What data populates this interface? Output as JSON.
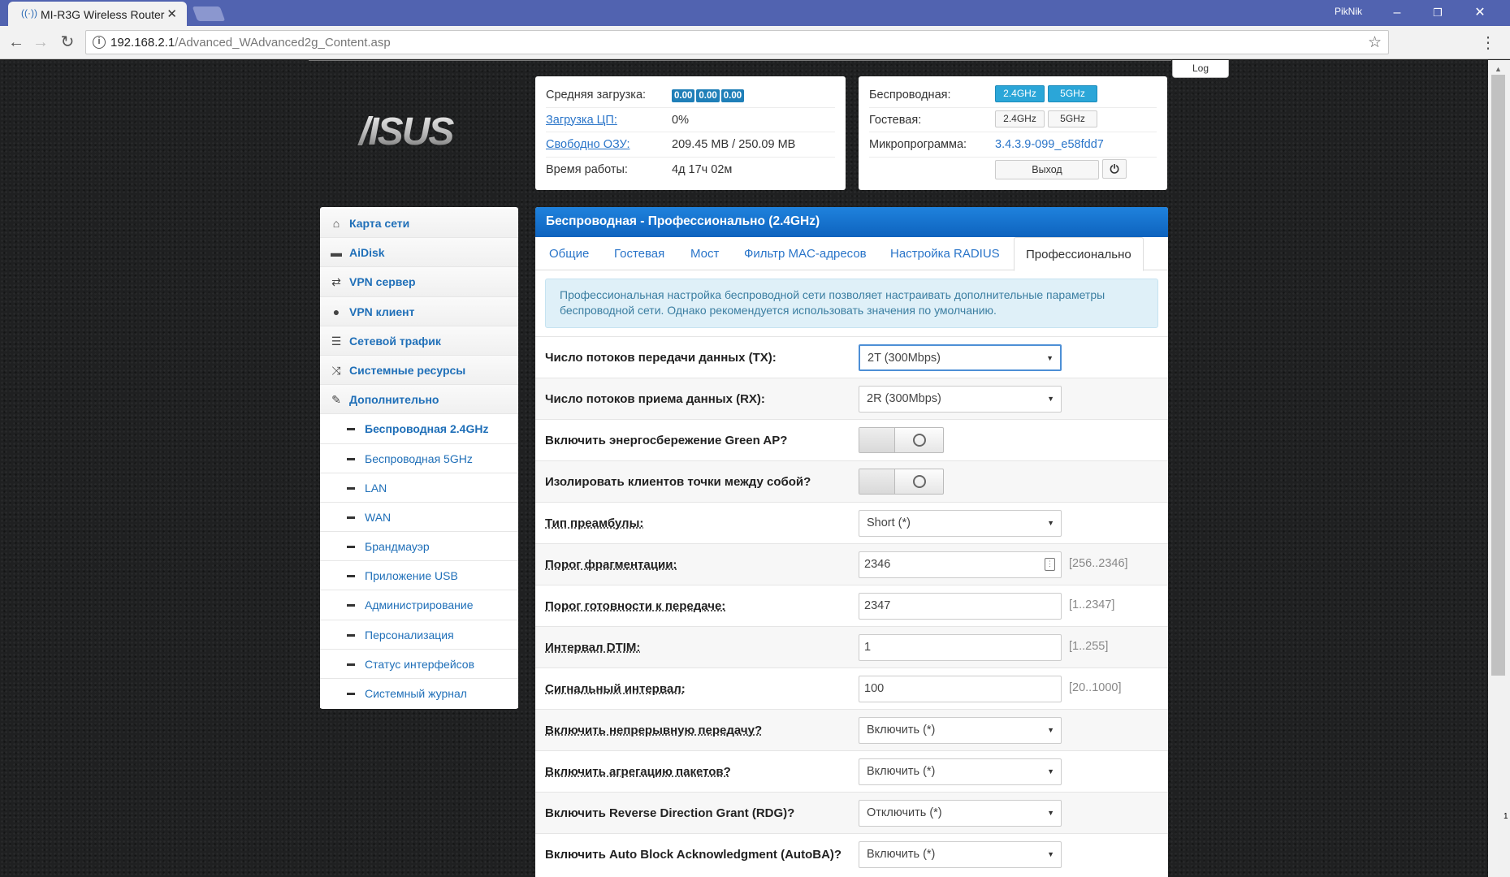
{
  "browser": {
    "tab_title": "MI-R3G Wireless Router",
    "favicon": "((·))",
    "close_glyph": "✕",
    "user": "PikNik",
    "minimize_glyph": "–",
    "restore_glyph": "❐",
    "close_window_glyph": "✕",
    "url_host": "192.168.2.1",
    "url_path": "/Advanced_WAdvanced2g_Content.asp"
  },
  "log_label": "Log",
  "logo_text": "/ISUS",
  "status": {
    "avg_load_label": "Средняя загрузка:",
    "avg_load_values": [
      "0.00",
      "0.00",
      "0.00"
    ],
    "cpu_label": "Загрузка ЦП:",
    "cpu_value": "0%",
    "ram_label": "Свободно ОЗУ:",
    "ram_value": "209.45 MB / 250.09 MB",
    "uptime_label": "Время работы:",
    "uptime_value": "4д 17ч 02м",
    "wireless_label": "Беспроводная:",
    "wireless_24": "2.4GHz",
    "wireless_5": "5GHz",
    "guest_label": "Гостевая:",
    "guest_24": "2.4GHz",
    "guest_5": "5GHz",
    "firmware_label": "Микропрограмма:",
    "firmware_value": "3.4.3.9-099_e58fdd7",
    "exit_label": "Выход",
    "power_glyph": "⏻"
  },
  "sidebar": {
    "items": [
      {
        "label": "Карта сети",
        "icon": "home-icon",
        "glyph": "⌂"
      },
      {
        "label": "AiDisk",
        "icon": "disk-icon",
        "glyph": "▬"
      },
      {
        "label": "VPN сервер",
        "icon": "retweet-icon",
        "glyph": "⇄"
      },
      {
        "label": "VPN клиент",
        "icon": "globe-icon",
        "glyph": "●"
      },
      {
        "label": "Сетевой трафик",
        "icon": "list-icon",
        "glyph": "☰"
      },
      {
        "label": "Системные ресурсы",
        "icon": "random-icon",
        "glyph": "⤨"
      },
      {
        "label": "Дополнительно",
        "icon": "wrench-icon",
        "glyph": "✎"
      }
    ],
    "subitems": [
      {
        "label": "Беспроводная 2.4GHz",
        "active": true
      },
      {
        "label": "Беспроводная 5GHz"
      },
      {
        "label": "LAN"
      },
      {
        "label": "WAN"
      },
      {
        "label": "Брандмауэр"
      },
      {
        "label": "Приложение USB"
      },
      {
        "label": "Администрирование"
      },
      {
        "label": "Персонализация"
      },
      {
        "label": "Статус интерфейсов"
      },
      {
        "label": "Системный журнал"
      }
    ]
  },
  "main": {
    "title": "Беспроводная - Профессионально (2.4GHz)",
    "tabs": [
      "Общие",
      "Гостевая",
      "Мост",
      "Фильтр MAC-адресов",
      "Настройка RADIUS",
      "Профессионально"
    ],
    "info": "Профессиональная настройка беспроводной сети позволяет настраивать дополнительные параметры беспроводной сети. Однако рекомендуется использовать значения по умолчанию.",
    "rows": [
      {
        "label": "Число потоков передачи данных (TX):",
        "type": "select",
        "value": "2T (300Mbps)"
      },
      {
        "label": "Число потоков приема данных (RX):",
        "type": "select",
        "value": "2R (300Mbps)"
      },
      {
        "label": "Включить энергосбережение Green AP?",
        "type": "toggle"
      },
      {
        "label": "Изолировать клиентов точки между собой?",
        "type": "toggle"
      },
      {
        "label": "Тип преамбулы:",
        "type": "select",
        "value": "Short (*)"
      },
      {
        "label": "Порог фрагментации:",
        "type": "input",
        "value": "2346",
        "range": "[256..2346]"
      },
      {
        "label": "Порог готовности к передаче:",
        "type": "input",
        "value": "2347",
        "range": "[1..2347]"
      },
      {
        "label": "Интервал DTIM:",
        "type": "input",
        "value": "1",
        "range": "[1..255]"
      },
      {
        "label": "Сигнальный интервал:",
        "type": "input",
        "value": "100",
        "range": "[20..1000]"
      },
      {
        "label": "Включить непрерывную передачу?",
        "type": "select",
        "value": "Включить (*)"
      },
      {
        "label": "Включить агрегацию пакетов?",
        "type": "select",
        "value": "Включить (*)"
      },
      {
        "label": "Включить Reverse Direction Grant (RDG)?",
        "type": "select",
        "value": "Отключить (*)"
      },
      {
        "label": "Включить Auto Block Acknowledgment (AutoBA)?",
        "type": "select",
        "value": "Включить (*)"
      }
    ]
  },
  "colors": {
    "header_blue": "#0e63be",
    "link_blue": "#2a75c9",
    "badge_blue": "#1f7fb8",
    "freq_on": "#2ba6d8",
    "info_bg": "#dff0f8"
  }
}
